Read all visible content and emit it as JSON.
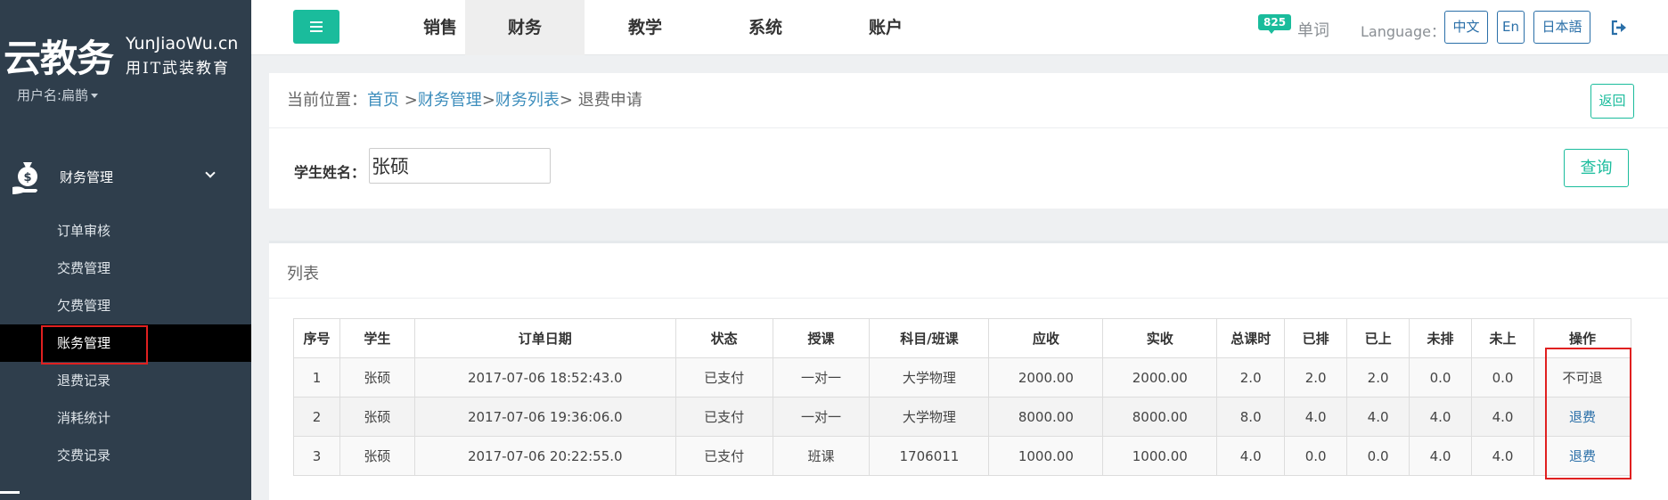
{
  "sidebar": {
    "logo_main": "云教务",
    "logo_en": "YunJiaoWu.cn",
    "logo_sub": "用IT武装教育",
    "user_name": "用户名:扁鹊",
    "menu_title": "财务管理",
    "items": [
      {
        "label": "订单审核"
      },
      {
        "label": "交费管理"
      },
      {
        "label": "欠费管理"
      },
      {
        "label": "账务管理"
      },
      {
        "label": "退费记录"
      },
      {
        "label": "消耗统计"
      },
      {
        "label": "交费记录"
      }
    ]
  },
  "topnav": {
    "tabs": [
      {
        "label": "销售"
      },
      {
        "label": "财务"
      },
      {
        "label": "教学"
      },
      {
        "label": "系统"
      },
      {
        "label": "账户"
      }
    ],
    "badge_count": "825",
    "word_link": "单词",
    "language_label": "Language：",
    "languages": [
      "中文",
      "En",
      "日本語"
    ]
  },
  "breadcrumb": {
    "prefix": "当前位置：",
    "home": "首页",
    "sep1": " >",
    "finance": "财务管理",
    "sep2": ">",
    "finance_list": "财务列表",
    "sep3": "> ",
    "current": "退费申请",
    "back_label": "返回"
  },
  "search": {
    "label": "学生姓名：",
    "value": "张硕",
    "button": "查询"
  },
  "list": {
    "title": "列表",
    "headers": [
      "序号",
      "学生",
      "订单日期",
      "状态",
      "授课",
      "科目/班课",
      "应收",
      "实收",
      "总课时",
      "已排",
      "已上",
      "未排",
      "未上",
      "操作"
    ],
    "rows": [
      [
        "1",
        "张硕",
        "2017-07-06 18:52:43.0",
        "已支付",
        "一对一",
        "大学物理",
        "2000.00",
        "2000.00",
        "2.0",
        "2.0",
        "2.0",
        "0.0",
        "0.0",
        "不可退"
      ],
      [
        "2",
        "张硕",
        "2017-07-06 19:36:06.0",
        "已支付",
        "一对一",
        "大学物理",
        "8000.00",
        "8000.00",
        "8.0",
        "4.0",
        "4.0",
        "4.0",
        "4.0",
        "退费"
      ],
      [
        "3",
        "张硕",
        "2017-07-06 20:22:55.0",
        "已支付",
        "班课",
        "1706011",
        "1000.00",
        "1000.00",
        "4.0",
        "0.0",
        "0.0",
        "4.0",
        "4.0",
        "退费"
      ]
    ]
  },
  "colors": {
    "accent": "#1abc9c",
    "sidebar_bg": "#2f3e4c",
    "link": "#2a6fa8",
    "highlight": "#e02020"
  }
}
